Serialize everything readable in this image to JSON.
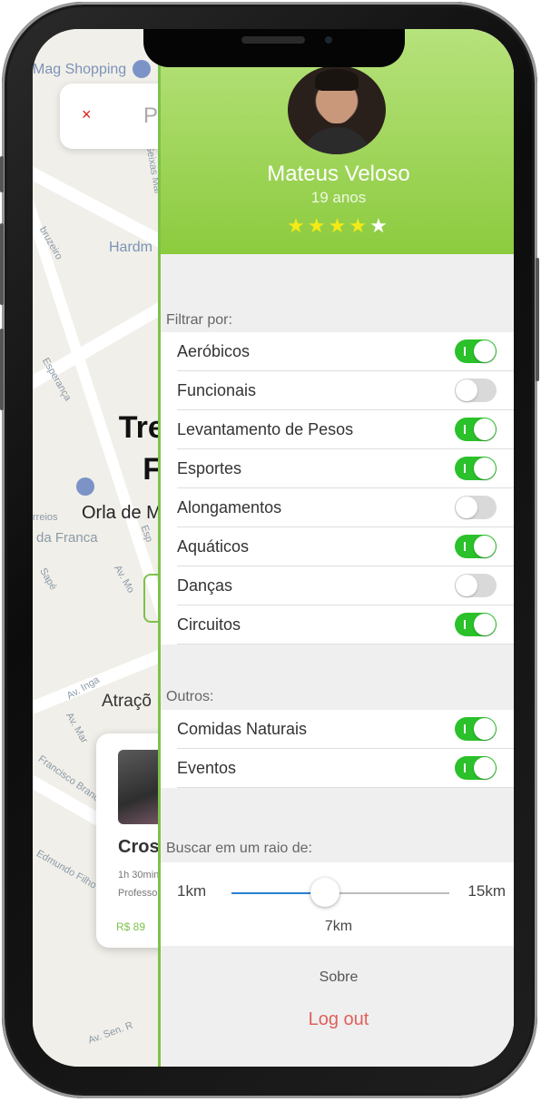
{
  "map": {
    "shopping_label": "Mag Shopping",
    "place_label": "Hardm",
    "streets": [
      "Dr. Seixas Mai",
      "Esperança",
      "Av. Inga",
      "Av. Mar",
      "Francisco Brand",
      "Edmundo Filho",
      "Av. Sen. R",
      "rreios",
      "da Franca",
      "Esp",
      "Av. Mo",
      "Sapé",
      "bruzeiro"
    ]
  },
  "search": {
    "close_symbol": "×",
    "placeholder": "P"
  },
  "background_page": {
    "title_line1": "Trein",
    "title_line2": "Fur",
    "subtitle": "Orla de M",
    "section": "Atraçõ",
    "card": {
      "title": "Cros",
      "meta1": "1h 30min",
      "meta2": "Professo",
      "price": "R$ 89"
    }
  },
  "profile": {
    "name": "Mateus Veloso",
    "age": "19 anos",
    "rating": 4,
    "rating_max": 5
  },
  "filters": {
    "label": "Filtrar por:",
    "items": [
      {
        "label": "Aeróbicos",
        "on": true
      },
      {
        "label": "Funcionais",
        "on": false
      },
      {
        "label": "Levantamento de Pesos",
        "on": true
      },
      {
        "label": "Esportes",
        "on": true
      },
      {
        "label": "Alongamentos",
        "on": false
      },
      {
        "label": "Aquáticos",
        "on": true
      },
      {
        "label": "Danças",
        "on": false
      },
      {
        "label": "Circuitos",
        "on": true
      }
    ]
  },
  "others": {
    "label": "Outros:",
    "items": [
      {
        "label": "Comidas Naturais",
        "on": true
      },
      {
        "label": "Eventos",
        "on": true
      }
    ]
  },
  "radius": {
    "label": "Buscar em um raio de:",
    "min_label": "1km",
    "max_label": "15km",
    "min": 1,
    "max": 15,
    "value": 7,
    "value_label": "7km"
  },
  "footer": {
    "about": "Sobre",
    "logout": "Log out"
  },
  "colors": {
    "accent": "#7cc24a",
    "toggle_on": "#2ac12a",
    "logout": "#e0605a",
    "star": "#f3ea16"
  }
}
